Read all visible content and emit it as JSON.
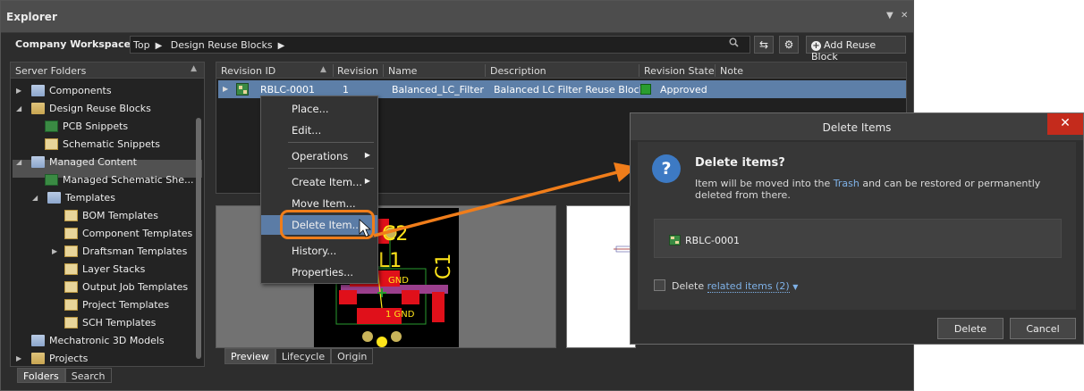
{
  "explorer": {
    "title": "Explorer",
    "workspace": "Company Workspace",
    "breadcrumb": [
      "Top",
      "Design Reuse Blocks"
    ],
    "add_button": "Add Reuse Block"
  },
  "left_panel": {
    "header": "Server Folders",
    "items": [
      {
        "label": "Components"
      },
      {
        "label": "Design Reuse Blocks"
      },
      {
        "label": "PCB Snippets"
      },
      {
        "label": "Schematic Snippets"
      },
      {
        "label": "Managed Content"
      },
      {
        "label": "Managed Schematic She..."
      },
      {
        "label": "Templates"
      },
      {
        "label": "BOM Templates"
      },
      {
        "label": "Component Templates"
      },
      {
        "label": "Draftsman Templates"
      },
      {
        "label": "Layer Stacks"
      },
      {
        "label": "Output Job Templates"
      },
      {
        "label": "Project Templates"
      },
      {
        "label": "SCH Templates"
      },
      {
        "label": "Mechatronic 3D Models"
      },
      {
        "label": "Projects"
      }
    ],
    "tabs": [
      "Folders",
      "Search"
    ]
  },
  "grid": {
    "columns": [
      "Revision ID",
      "Revision",
      "Name",
      "Description",
      "Revision State",
      "Note"
    ],
    "rows": [
      {
        "revision_id": "RBLC-0001",
        "revision": "1",
        "name": "Balanced_LC_Filter",
        "description": "Balanced LC Filter Reuse Block",
        "state": "Approved",
        "note": ""
      }
    ]
  },
  "preview": {
    "tabs": [
      "Preview",
      "Lifecycle",
      "Origin"
    ],
    "pcb_labels": [
      "C2",
      "L1",
      "C1",
      "GND",
      "1 GND"
    ],
    "pcb_colors": {
      "board": "#000000",
      "pad": "#e0101a",
      "silk": "#ffe51a",
      "copper": "#9a3f8c"
    }
  },
  "context_menu": {
    "items": [
      {
        "label": "Place..."
      },
      {
        "label": "Edit..."
      },
      {
        "label": "Operations"
      },
      {
        "label": "Create Item..."
      },
      {
        "label": "Move Item..."
      },
      {
        "label": "Delete Item..."
      },
      {
        "label": "History..."
      },
      {
        "label": "Properties..."
      }
    ]
  },
  "dialog": {
    "title": "Delete Items",
    "heading": "Delete items?",
    "msg_pre": "Item will be moved into the ",
    "msg_link": "Trash",
    "msg_post": " and can be restored or permanently deleted from there.",
    "item": "RBLC-0001",
    "checkbox_label": "Delete ",
    "checkbox_link": "related items (2)",
    "buttons": {
      "delete": "Delete",
      "cancel": "Cancel"
    }
  },
  "colors": {
    "accent": "#f07d1a",
    "selection": "#5d7fa8",
    "approved": "#2a9d2f",
    "close": "#c42b1c"
  }
}
